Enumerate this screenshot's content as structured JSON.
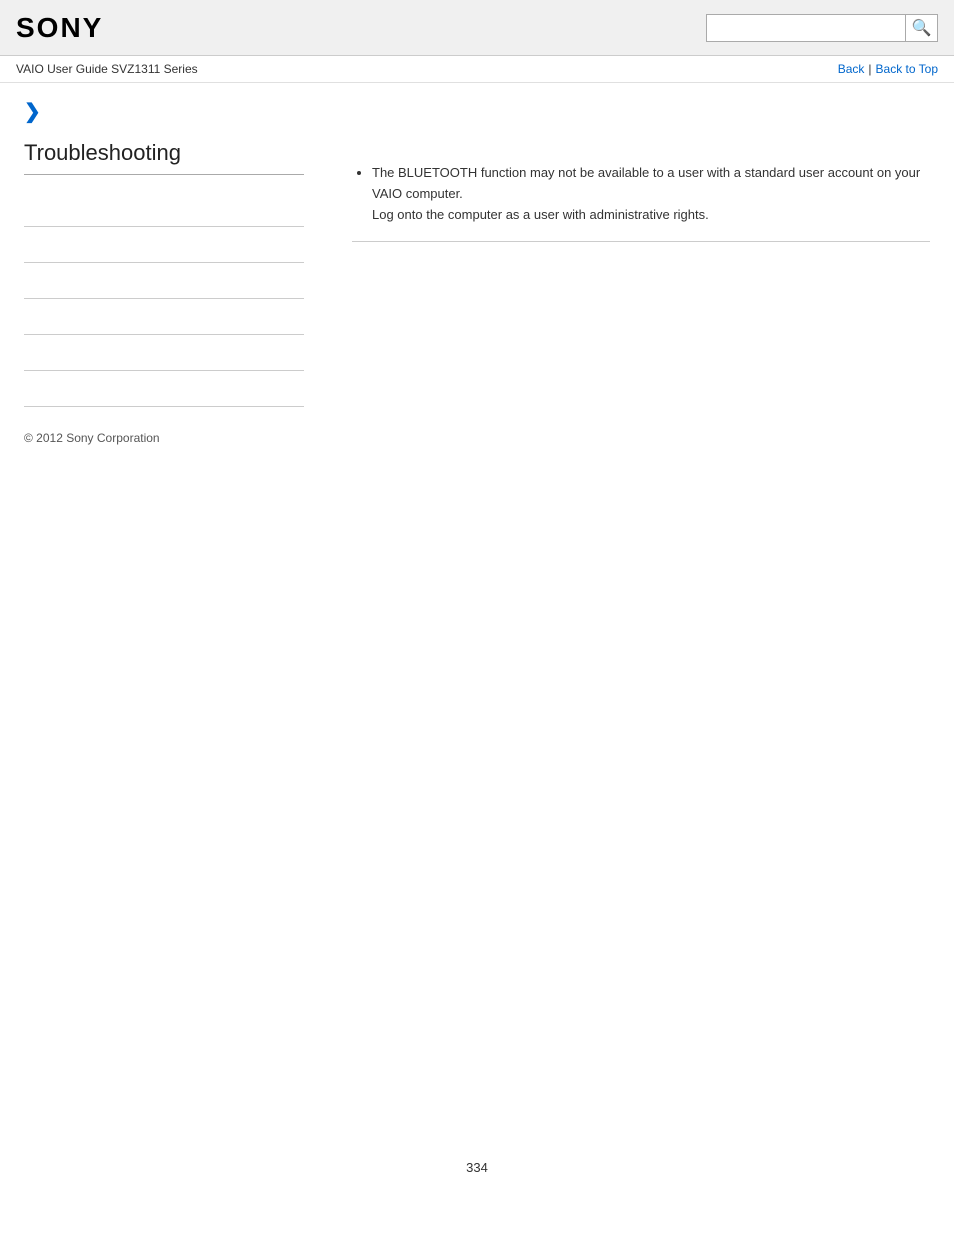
{
  "header": {
    "logo": "SONY",
    "search_placeholder": "",
    "search_icon": "🔍"
  },
  "nav": {
    "breadcrumb": "VAIO User Guide SVZ1311 Series",
    "back_label": "Back",
    "separator": "|",
    "back_to_top_label": "Back to Top"
  },
  "sidebar": {
    "chevron": "❯",
    "title": "Troubleshooting",
    "links": [
      {
        "label": ""
      },
      {
        "label": ""
      },
      {
        "label": ""
      },
      {
        "label": ""
      },
      {
        "label": ""
      },
      {
        "label": ""
      }
    ],
    "footer": "© 2012 Sony Corporation"
  },
  "content": {
    "bullet_main": "The BLUETOOTH function may not be available to a user with a standard user account on your VAIO computer.",
    "bullet_sub": "Log onto the computer as a user with administrative rights."
  },
  "page_number": "334"
}
